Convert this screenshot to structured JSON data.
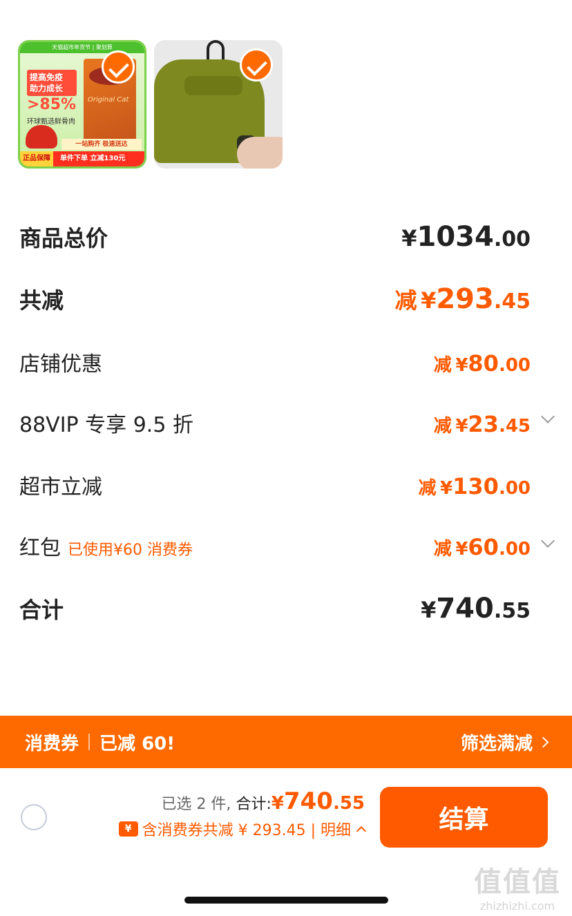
{
  "products": [
    {
      "name": "cat-food",
      "ad_banner": "天猫超市年货节 | 聚划算",
      "ad_badge": "提高免疫 助力成长",
      "ad_percent": ">85%",
      "ad_subtitle": "环球甄选鲜骨肉",
      "bag_text": "Original Cat",
      "ad_mid": "一站购齐 极速送达",
      "ad_strip_left": "正品保障",
      "ad_strip_right": "单件下单 立减130元",
      "selected": true
    },
    {
      "name": "olive-sweater",
      "selected": true
    }
  ],
  "summary_rows": {
    "total_goods": {
      "label": "商品总价",
      "yen": "¥",
      "int": "1034",
      "dec": ".00"
    },
    "total_discount": {
      "label": "共减",
      "prefix": "减",
      "yen": "¥",
      "int": "293",
      "dec": ".45"
    },
    "store_discount": {
      "label": "店铺优惠",
      "prefix": "减",
      "yen": "¥",
      "int": "80",
      "dec": ".00"
    },
    "vip_discount": {
      "label": "88VIP 专享 9.5 折",
      "prefix": "减",
      "yen": "¥",
      "int": "23",
      "dec": ".45"
    },
    "supermarket_discount": {
      "label": "超市立减",
      "prefix": "减",
      "yen": "¥",
      "int": "130",
      "dec": ".00"
    },
    "red_packet": {
      "label": "红包",
      "note": "已使用¥60 消费券",
      "prefix": "减",
      "yen": "¥",
      "int": "60",
      "dec": ".00"
    },
    "grand_total": {
      "label": "合计",
      "yen": "¥",
      "int": "740",
      "dec": ".55"
    }
  },
  "coupon_bar": {
    "title": "消费券",
    "status": "已减 60!",
    "action": "筛选满减"
  },
  "footer": {
    "selected_count": "已选 2 件,",
    "total_label": "合计:",
    "yen": "¥",
    "int": "740",
    "dec": ".55",
    "coupon_icon": "¥",
    "discount_note": "含消费券共减 ¥ 293.45 | 明细",
    "checkout_label": "结算"
  },
  "watermark": {
    "logo": "值值值",
    "url": "zhizhizhi.com"
  },
  "colors": {
    "accent": "#ff5a00",
    "bar": "#ff6a00"
  }
}
